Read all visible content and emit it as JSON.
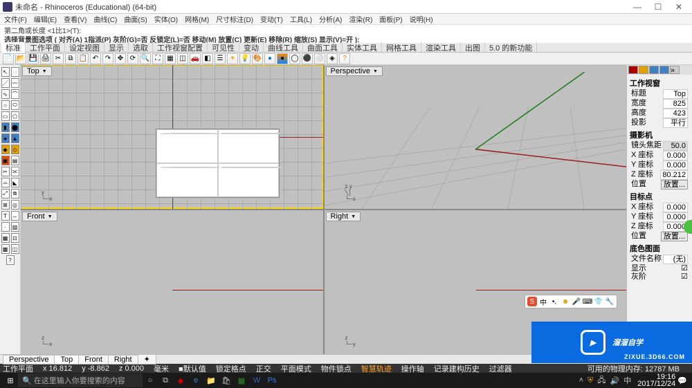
{
  "title": "未命名 - Rhinoceros (Educational) (64-bit)",
  "menu": [
    "文件(F)",
    "编辑(E)",
    "查看(V)",
    "曲线(C)",
    "曲面(S)",
    "实体(O)",
    "网格(M)",
    "尺寸标注(D)",
    "变动(T)",
    "工具(L)",
    "分析(A)",
    "渲染(R)",
    "面板(P)",
    "说明(H)"
  ],
  "cmd1": "第二角或长度 <1比1>(T):",
  "cmd2": "选择背景图选项 ( 对齐(A)  1指派(P)  灰阶(G)=否  反锁定(L)=否  移动(M)  放置(C)  更新(E)  移除(R)  缩放(S)  显示(V)=开 ):",
  "tabs": [
    "标准",
    "工作平面",
    "设定视图",
    "显示",
    "选取",
    "工作视窗配置",
    "可见性",
    "变动",
    "曲线工具",
    "曲面工具",
    "实体工具",
    "网格工具",
    "渲染工具",
    "出图",
    "5.0 的新功能"
  ],
  "viewports": {
    "top": "Top",
    "persp": "Perspective",
    "front": "Front",
    "right": "Right"
  },
  "vptabs": [
    "Perspective",
    "Top",
    "Front",
    "Right"
  ],
  "status": {
    "plane": "工作平面",
    "x": "x 16.812",
    "y": "y -8.862",
    "z": "z 0.000",
    "mm": "毫米",
    "def": "■默认值",
    "items": [
      "锁定格点",
      "正交",
      "平面模式",
      "物件锁点",
      "智慧轨迹",
      "操作轴",
      "记录建构历史",
      "过滤器"
    ],
    "mem": "可用的物理内存: 12787 MB"
  },
  "panel": {
    "h1": "工作视窗",
    "r1": {
      "k": "标题",
      "v": "Top"
    },
    "r2": {
      "k": "宽度",
      "v": "825"
    },
    "r3": {
      "k": "高度",
      "v": "423"
    },
    "r4": {
      "k": "投影",
      "v": "平行"
    },
    "h2": "摄影机",
    "r5": {
      "k": "镜头焦距",
      "v": "50.0"
    },
    "r6": {
      "k": "X 座标",
      "v": "0.000"
    },
    "r7": {
      "k": "Y 座标",
      "v": "0.000"
    },
    "r8": {
      "k": "Z 座标",
      "v": "80.212"
    },
    "r9": {
      "k": "位置",
      "v": "放置..."
    },
    "h3": "目标点",
    "r10": {
      "k": "X 座标",
      "v": "0.000"
    },
    "r11": {
      "k": "Y 座标",
      "v": "0.000"
    },
    "r12": {
      "k": "Z 座标",
      "v": "0.000"
    },
    "r13": {
      "k": "位置",
      "v": "放置..."
    },
    "h4": "底色图面",
    "r14": {
      "k": "文件名称",
      "v": "(无)"
    },
    "r15": {
      "k": "显示",
      "v": "☑"
    },
    "r16": {
      "k": "灰阶",
      "v": "☑"
    }
  },
  "watermark": {
    "brand": "溜溜自学",
    "url": "ZIXUE.3D66.COM"
  },
  "taskbar": {
    "search": "在这里输入你要搜索的内容",
    "time": "19:16",
    "date": "2017/12/24"
  }
}
